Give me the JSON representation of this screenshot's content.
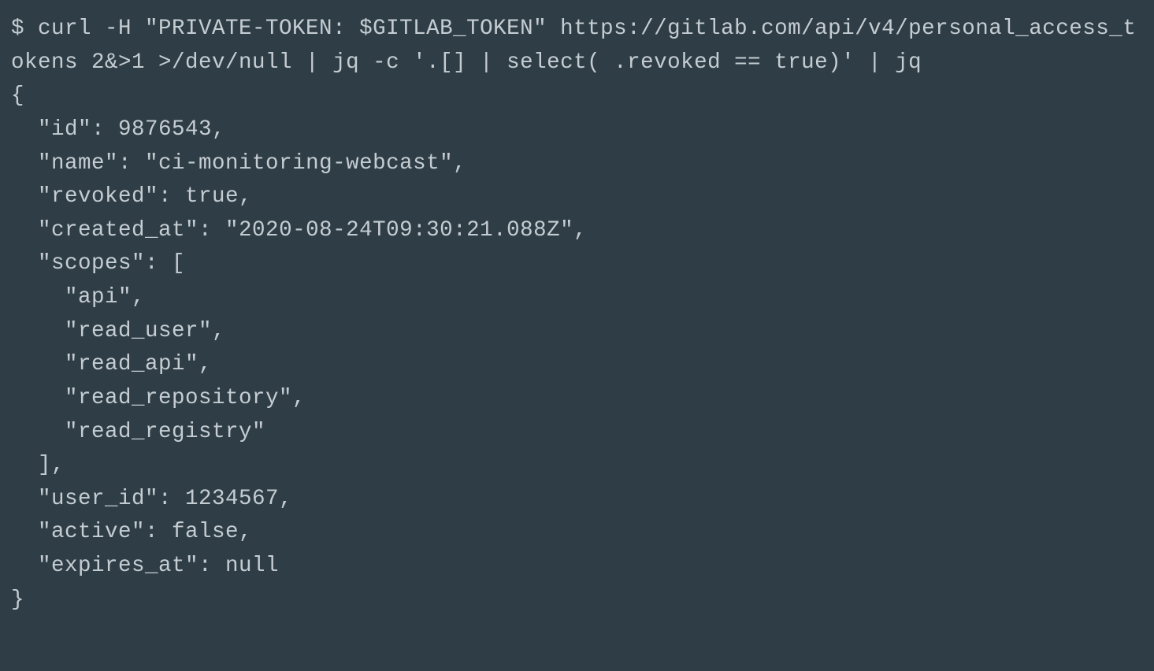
{
  "terminal": {
    "command": "$ curl -H \"PRIVATE-TOKEN: $GITLAB_TOKEN\" https://gitlab.com/api/v4/personal_access_tokens 2&>1 >/dev/null | jq -c '.[] | select( .revoked == true)' | jq",
    "output": "{\n  \"id\": 9876543,\n  \"name\": \"ci-monitoring-webcast\",\n  \"revoked\": true,\n  \"created_at\": \"2020-08-24T09:30:21.088Z\",\n  \"scopes\": [\n    \"api\",\n    \"read_user\",\n    \"read_api\",\n    \"read_repository\",\n    \"read_registry\"\n  ],\n  \"user_id\": 1234567,\n  \"active\": false,\n  \"expires_at\": null\n}",
    "response": {
      "id": 9876543,
      "name": "ci-monitoring-webcast",
      "revoked": true,
      "created_at": "2020-08-24T09:30:21.088Z",
      "scopes": [
        "api",
        "read_user",
        "read_api",
        "read_repository",
        "read_registry"
      ],
      "user_id": 1234567,
      "active": false,
      "expires_at": null
    }
  }
}
